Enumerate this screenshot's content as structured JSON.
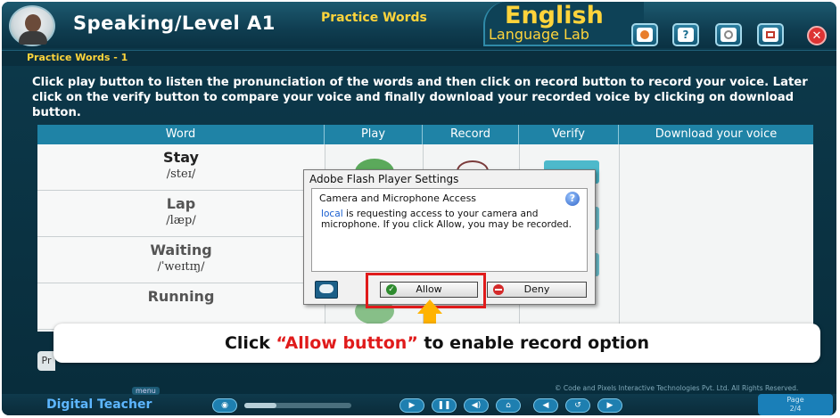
{
  "header": {
    "title": "Speaking/Level A1",
    "section": "Practice Words",
    "brand_line1": "English",
    "brand_line2": "Language Lab"
  },
  "subheader": "Practice Words - 1",
  "instructions": "Click play button to listen the pronunciation of the words and then click on record button to record your voice. Later click on the verify button to compare your voice and finally download your recorded voice by clicking on download button.",
  "table": {
    "columns": [
      "Word",
      "Play",
      "Record",
      "Verify",
      "Download your voice"
    ],
    "rows": [
      {
        "word": "Stay",
        "ipa": "/steɪ/"
      },
      {
        "word": "Lap",
        "ipa": "/læp/"
      },
      {
        "word": "Waiting",
        "ipa": "/ˈweɪtɪŋ/"
      },
      {
        "word": "Running",
        "ipa": ""
      }
    ]
  },
  "dialog": {
    "title": "Adobe Flash Player Settings",
    "heading": "Camera and Microphone Access",
    "link": "local",
    "message_rest": " is requesting access to your camera and microphone. If you click Allow, you may be recorded.",
    "allow_label": "Allow",
    "deny_label": "Deny"
  },
  "callout": {
    "prefix": "Click ",
    "highlight": "“Allow button”",
    "suffix": " to enable record option"
  },
  "footer": {
    "copyright": "© Code and Pixels Interactive Technologies Pvt. Ltd. All Rights Reserved.",
    "logo": "Digital Teacher",
    "menu": "menu",
    "page_label": "Page",
    "page_value": "2/4",
    "seek_progress": 0.3
  },
  "colors": {
    "accent": "#ffd43b",
    "table_header": "#1f83a6",
    "highlight_red": "#e01b1b"
  },
  "icons": [
    "avatar-icon",
    "camera-icon",
    "help-icon",
    "settings-icon",
    "notes-icon",
    "close-icon",
    "monitor-icon"
  ]
}
